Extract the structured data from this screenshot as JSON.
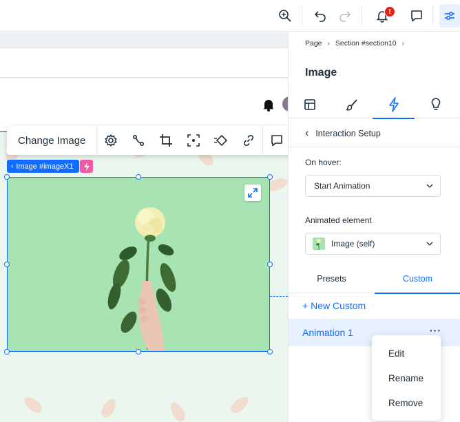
{
  "topbar": {
    "notification_count": "!",
    "icons": [
      "zoom-in-icon",
      "undo-icon",
      "redo-icon",
      "bell-icon",
      "chat-icon",
      "inspector-icon"
    ]
  },
  "toolbar": {
    "change_image_label": "Change Image",
    "icons": [
      "settings-icon",
      "animation-path-icon",
      "crop-icon",
      "focal-point-icon",
      "interactions-icon",
      "link-icon",
      "comment-icon"
    ]
  },
  "selection": {
    "label": "Image #imageX1"
  },
  "panel": {
    "breadcrumb": [
      "Page",
      "Section #section10"
    ],
    "title": "Image",
    "tabs": [
      "layout-icon",
      "design-icon",
      "interactions-icon",
      "tips-icon"
    ],
    "active_tab": 2,
    "back_label": "Interaction Setup",
    "trigger_label": "On hover:",
    "trigger_value": "Start Animation",
    "element_label": "Animated element",
    "element_value": "Image (self)",
    "subtabs": [
      "Presets",
      "Custom"
    ],
    "active_subtab": 1,
    "new_custom_label": "+ New Custom",
    "animation_item": "Animation 1",
    "more_label": "···"
  },
  "context_menu": {
    "items": [
      "Edit",
      "Rename",
      "Remove"
    ]
  },
  "colors": {
    "accent": "#116dff",
    "image_bg": "#a7e3b3",
    "interaction_badge": "#ee5ba0",
    "section_bg": "#eaf6ee"
  }
}
